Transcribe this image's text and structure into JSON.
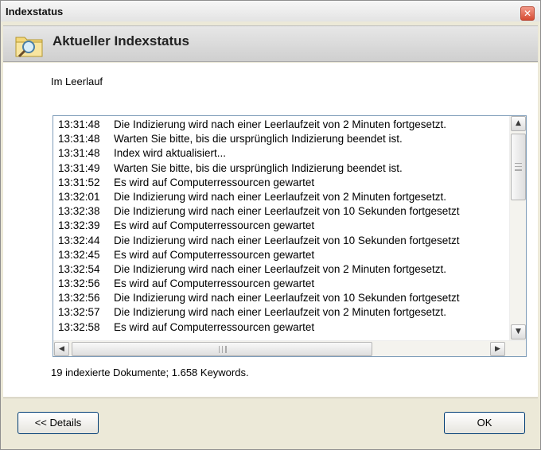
{
  "window": {
    "title": "Indexstatus",
    "close_glyph": "✕"
  },
  "header": {
    "title": "Aktueller Indexstatus",
    "icon": "folder-search-icon"
  },
  "status": {
    "text": "Im Leerlauf"
  },
  "log": {
    "entries": [
      {
        "time": "13:31:48",
        "message": "Die Indizierung wird nach einer Leerlaufzeit von 2 Minuten fortgesetzt."
      },
      {
        "time": "13:31:48",
        "message": "Warten Sie bitte, bis die ursprünglich Indizierung beendet ist."
      },
      {
        "time": "13:31:48",
        "message": "Index wird aktualisiert..."
      },
      {
        "time": "13:31:49",
        "message": "Warten Sie bitte, bis die ursprünglich Indizierung beendet ist."
      },
      {
        "time": "13:31:52",
        "message": "Es wird auf Computerressourcen gewartet"
      },
      {
        "time": "13:32:01",
        "message": "Die Indizierung wird nach einer Leerlaufzeit von 2 Minuten fortgesetzt."
      },
      {
        "time": "13:32:38",
        "message": "Die Indizierung wird nach einer Leerlaufzeit von 10 Sekunden fortgesetzt"
      },
      {
        "time": "13:32:39",
        "message": "Es wird auf Computerressourcen gewartet"
      },
      {
        "time": "13:32:44",
        "message": "Die Indizierung wird nach einer Leerlaufzeit von 10 Sekunden fortgesetzt"
      },
      {
        "time": "13:32:45",
        "message": "Es wird auf Computerressourcen gewartet"
      },
      {
        "time": "13:32:54",
        "message": "Die Indizierung wird nach einer Leerlaufzeit von 2 Minuten fortgesetzt."
      },
      {
        "time": "13:32:56",
        "message": "Es wird auf Computerressourcen gewartet"
      },
      {
        "time": "13:32:56",
        "message": "Die Indizierung wird nach einer Leerlaufzeit von 10 Sekunden fortgesetzt"
      },
      {
        "time": "13:32:57",
        "message": "Die Indizierung wird nach einer Leerlaufzeit von 2 Minuten fortgesetzt."
      },
      {
        "time": "13:32:58",
        "message": "Es wird auf Computerressourcen gewartet"
      }
    ]
  },
  "summary": {
    "text": "19 indexierte Dokumente; 1.658 Keywords."
  },
  "buttons": {
    "details_label": "<< Details",
    "ok_label": "OK"
  },
  "scrollbar": {
    "up": "▲",
    "down": "▼",
    "left": "◀",
    "right": "▶"
  }
}
